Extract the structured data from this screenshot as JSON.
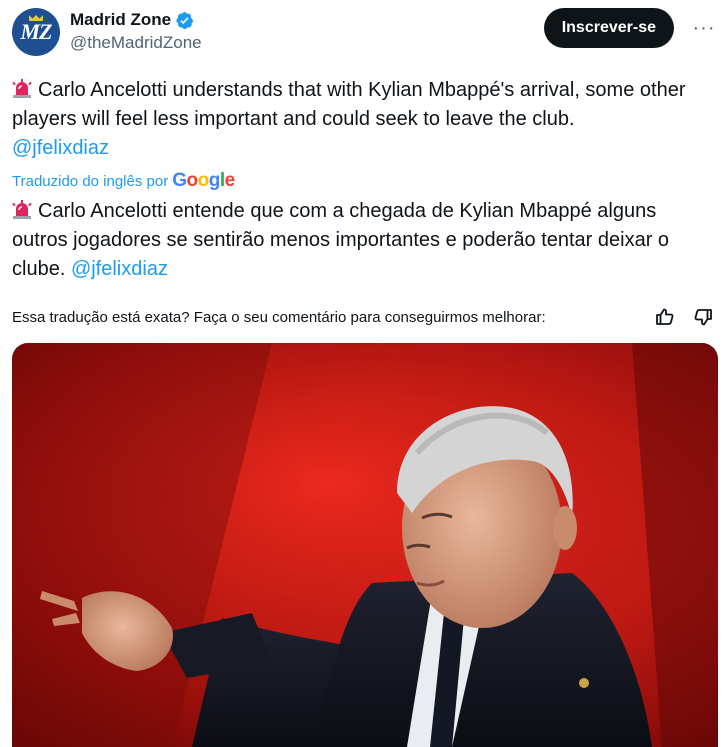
{
  "account": {
    "display_name": "Madrid Zone",
    "handle": "@theMadridZone",
    "avatar_text": "MZ"
  },
  "actions": {
    "subscribe_label": "Inscrever-se",
    "more_label": "···"
  },
  "tweet": {
    "text": "Carlo Ancelotti understands that with Kylian Mbappé's arrival, some other players will feel less important and could seek to leave the club.",
    "mention": "@jfelixdiaz"
  },
  "translation": {
    "label": "Traduzido do inglês por",
    "google": [
      "G",
      "o",
      "o",
      "g",
      "l",
      "e"
    ],
    "text": "Carlo Ancelotti entende que com a chegada de Kylian Mbappé alguns outros jogadores se sentirão menos importantes e poderão tentar deixar o clube.",
    "mention": "@jfelixdiaz",
    "feedback_question": "Essa tradução está exata? Faça o seu comentário para conseguirmos melhorar:"
  },
  "colors": {
    "accent": "#1d9bf0",
    "subscribe_bg": "#0f1419",
    "verified": "#1d9bf0"
  },
  "icons": {
    "siren": "police-light-icon",
    "thumbs_up": "thumbs-up-icon",
    "thumbs_down": "thumbs-down-icon",
    "verified": "verified-badge-icon"
  }
}
